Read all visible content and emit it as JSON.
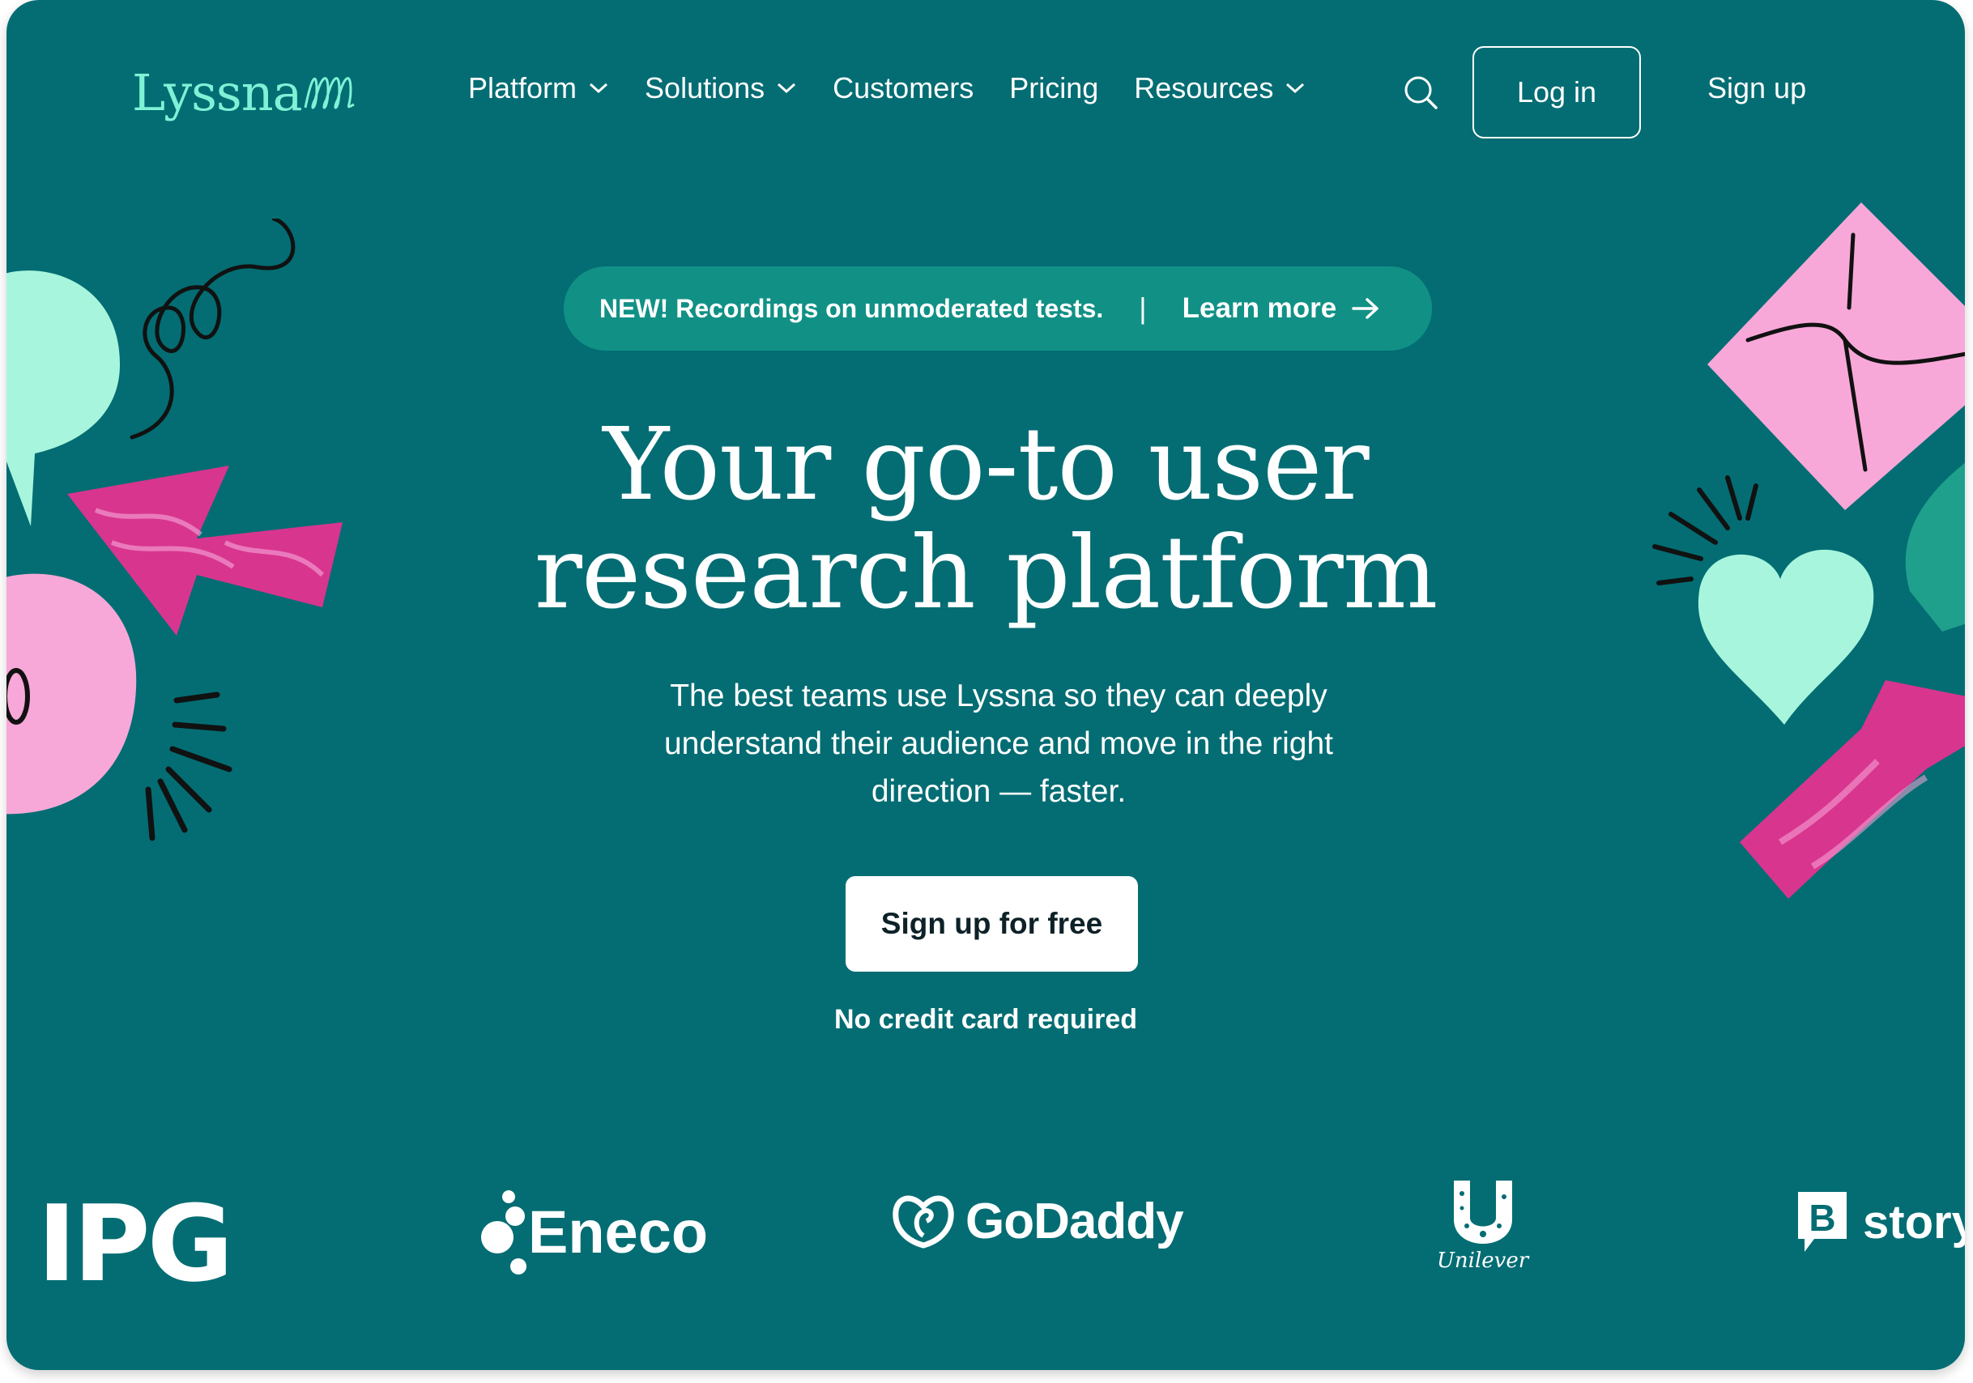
{
  "nav": {
    "logo": "Lyssna",
    "items": [
      {
        "label": "Platform",
        "dropdown": true
      },
      {
        "label": "Solutions",
        "dropdown": true
      },
      {
        "label": "Customers",
        "dropdown": false
      },
      {
        "label": "Pricing",
        "dropdown": false
      },
      {
        "label": "Resources",
        "dropdown": true
      }
    ],
    "login": "Log in",
    "signup": "Sign up"
  },
  "banner": {
    "text": "NEW! Recordings on unmoderated tests.",
    "separator": "|",
    "link": "Learn more"
  },
  "hero": {
    "title_line1": "Your go-to user",
    "title_line2": "research platform",
    "subtitle": "The best teams use Lyssna so they can deeply understand their audience and move in the right direction — faster.",
    "cta": "Sign up for free",
    "note": "No credit card required"
  },
  "brands": {
    "ipg": "IPG",
    "eneco": "Eneco",
    "godaddy": "GoDaddy",
    "unilever": "Unilever",
    "story": "story"
  },
  "colors": {
    "background": "#036D73",
    "banner": "#119186",
    "mint": "#A8F5DD",
    "pink": "#F7A8D8",
    "magenta": "#D8358F"
  },
  "icons": [
    "chevron-down-icon",
    "search-icon",
    "arrow-right-icon"
  ]
}
